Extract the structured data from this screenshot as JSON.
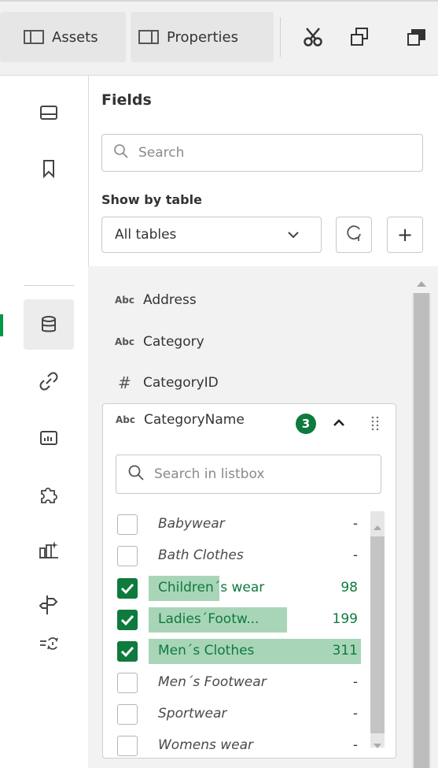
{
  "toolbar": {
    "assets_label": "Assets",
    "properties_label": "Properties",
    "icons": [
      "cut-icon",
      "copy-icon",
      "paste-icon"
    ]
  },
  "rail": {
    "items": [
      "sheet-icon",
      "bookmark-icon",
      "database-icon",
      "link-icon",
      "chart-icon",
      "puzzle-icon",
      "sparkle-chart-icon",
      "signpost-icon",
      "refresh-filter-icon"
    ],
    "active": "database-icon"
  },
  "fields": {
    "title": "Fields",
    "search_placeholder": "Search",
    "show_by_label": "Show by table",
    "table_select_value": "All tables",
    "add_label": "+",
    "list": [
      {
        "type": "Abc",
        "name": "Address"
      },
      {
        "type": "Abc",
        "name": "Category"
      },
      {
        "type": "#",
        "name": "CategoryID"
      }
    ]
  },
  "listbox": {
    "type": "Abc",
    "title": "CategoryName",
    "selected_count": "3",
    "search_placeholder": "Search in listbox",
    "items": [
      {
        "label": "Babywear",
        "freq": "-",
        "selected": false
      },
      {
        "label": "Bath Clothes",
        "freq": "-",
        "selected": false
      },
      {
        "label": "Children´s wear",
        "freq": "98",
        "selected": true
      },
      {
        "label": "Ladies´Footw...",
        "freq": "199",
        "selected": true
      },
      {
        "label": "Men´s Clothes",
        "freq": "311",
        "selected": true
      },
      {
        "label": "Men´s Footwear",
        "freq": "-",
        "selected": false
      },
      {
        "label": "Sportwear",
        "freq": "-",
        "selected": false
      },
      {
        "label": "Womens wear",
        "freq": "-",
        "selected": false
      }
    ]
  },
  "colors": {
    "accent_green": "#0e7a3d",
    "selection_bar": "#a8d5b8"
  }
}
